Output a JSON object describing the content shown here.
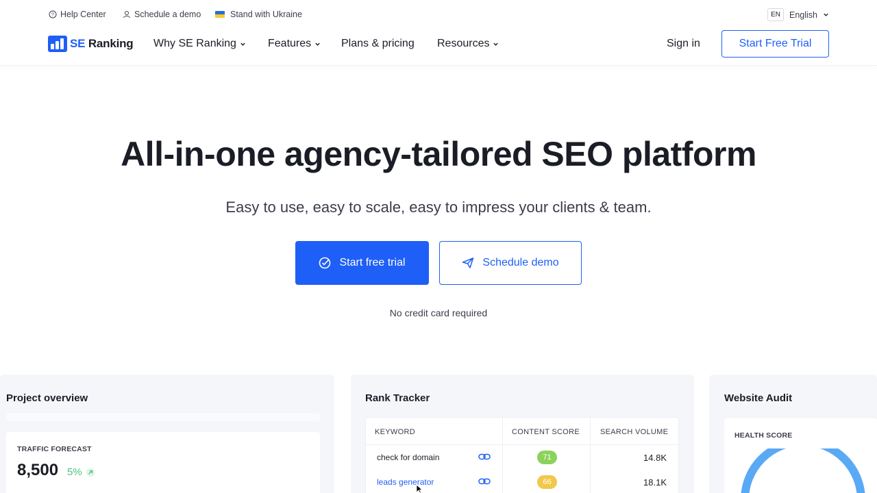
{
  "topbar": {
    "help_center": "Help Center",
    "schedule_demo": "Schedule a demo",
    "stand_with_ukraine": "Stand with Ukraine",
    "lang_code": "EN",
    "lang_label": "English"
  },
  "nav": {
    "logo_prefix": "SE",
    "logo_name": "Ranking",
    "items": [
      "Why SE Ranking",
      "Features",
      "Plans & pricing",
      "Resources"
    ],
    "sign_in": "Sign in",
    "start_free_trial": "Start Free Trial"
  },
  "hero": {
    "title": "All-in-one agency-tailored SEO platform",
    "subtitle": "Easy to use, easy to scale, easy to impress your clients & team.",
    "primary_button": "Start free trial",
    "secondary_button": "Schedule demo",
    "note": "No credit card required"
  },
  "cards": {
    "project_overview": {
      "title": "Project overview",
      "caption": "TRAFFIC FORECAST",
      "value": "8,500",
      "change": "5%"
    },
    "rank_tracker": {
      "title": "Rank Tracker",
      "columns": [
        "KEYWORD",
        "CONTENT SCORE",
        "SEARCH VOLUME"
      ],
      "rows": [
        {
          "keyword": "check for domain",
          "score": "71",
          "volume": "14.8K"
        },
        {
          "keyword": "leads generator",
          "score": "66",
          "volume": "18.1K"
        }
      ]
    },
    "website_audit": {
      "title": "Website Audit",
      "caption": "HEALTH SCORE"
    }
  },
  "colors": {
    "brand": "#1e5ff7",
    "score_green": "#8bd35c",
    "score_yellow": "#f2c84b",
    "gauge": "#5aa9f5"
  }
}
